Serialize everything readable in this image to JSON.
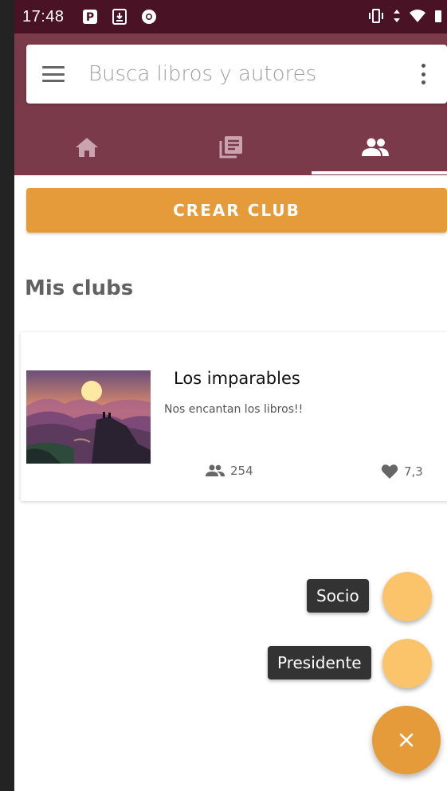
{
  "status_bar": {
    "time": "17:48",
    "left_icons": [
      "parking-icon",
      "download-icon",
      "chrome-icon"
    ],
    "right_icons": [
      "vibrate-icon",
      "data-arrows-icon",
      "wifi-icon",
      "battery-icon"
    ]
  },
  "search": {
    "placeholder": "Busca libros y autores"
  },
  "tabs": [
    {
      "name": "home",
      "icon": "home-icon",
      "selected": false
    },
    {
      "name": "library",
      "icon": "library-icon",
      "selected": false
    },
    {
      "name": "clubs",
      "icon": "group-icon",
      "selected": true
    }
  ],
  "create_club": {
    "label": "CREAR CLUB"
  },
  "my_clubs": {
    "title": "Mis clubs",
    "clubs": [
      {
        "name": "Los imparables",
        "description": "Nos encantan los libros!!",
        "members": "254",
        "rating": "7,3"
      }
    ]
  },
  "fab_menu": {
    "socio_label": "Socio",
    "presidente_label": "Presidente",
    "close_icon": "close-icon"
  },
  "colors": {
    "status_bar": "#4a1325",
    "header": "#7b3a4a",
    "accent": "#e69b3a",
    "mini_fab": "#fcc46a"
  }
}
